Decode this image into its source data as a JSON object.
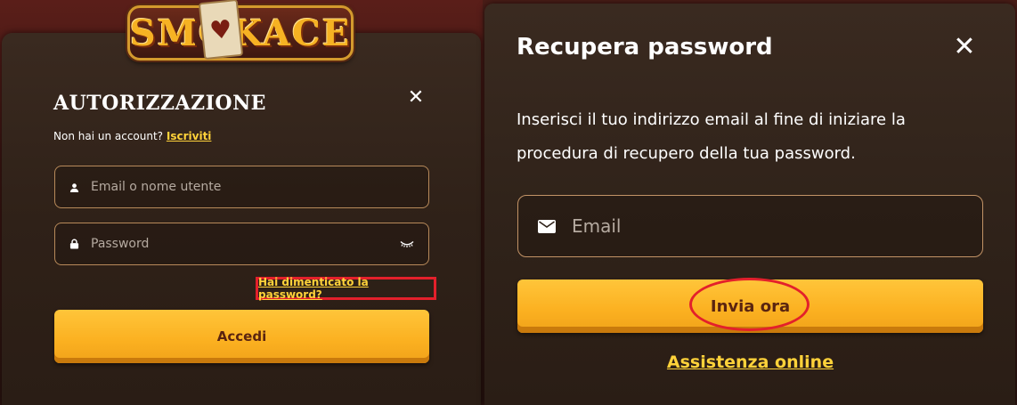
{
  "brand": {
    "logo_text": "SMOKACE"
  },
  "login": {
    "title": "AUTORIZZAZIONE",
    "no_account": "Non hai un account?",
    "register_link": "Iscriviti",
    "email_placeholder": "Email o nome utente",
    "password_placeholder": "Password",
    "forgot_link": "Hai dimenticato la password?",
    "submit_label": "Accedi",
    "icons": {
      "user": "user-icon",
      "lock": "lock-icon",
      "eye": "eye-closed-icon",
      "close": "close-icon"
    }
  },
  "recover": {
    "title": "Recupera password",
    "description": "Inserisci il tuo indirizzo email al fine di iniziare la procedura di recupero della tua password.",
    "email_placeholder": "Email",
    "submit_label": "Invia ora",
    "support_link": "Assistenza online",
    "icons": {
      "mail": "envelope-icon",
      "close": "close-icon"
    }
  },
  "colors": {
    "accent": "#ffd23a",
    "button": "#fbb020",
    "highlight": "#e3202b"
  }
}
